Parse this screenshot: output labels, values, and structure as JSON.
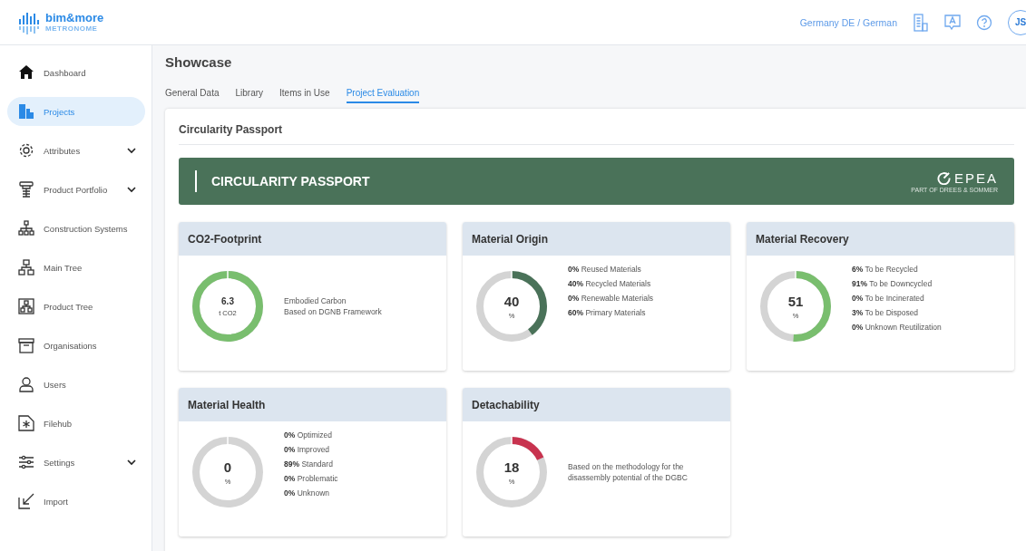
{
  "header": {
    "brand": "bim&more",
    "brand_sub": "METRONOME",
    "locale": "Germany DE / German",
    "avatar": "JS"
  },
  "sidebar": {
    "items": [
      {
        "label": "Dashboard",
        "kind": "link",
        "selected": false
      },
      {
        "label": "Projects",
        "kind": "link",
        "selected": true
      },
      {
        "label": "Attributes",
        "kind": "group",
        "selected": false
      },
      {
        "label": "Product Portfolio",
        "kind": "group",
        "selected": false
      },
      {
        "label": "Construction Systems",
        "kind": "link",
        "selected": false
      },
      {
        "label": "Main Tree",
        "kind": "link",
        "selected": false
      },
      {
        "label": "Product Tree",
        "kind": "link",
        "selected": false
      },
      {
        "label": "Organisations",
        "kind": "link",
        "selected": false
      },
      {
        "label": "Users",
        "kind": "link",
        "selected": false
      },
      {
        "label": "Filehub",
        "kind": "link",
        "selected": false
      },
      {
        "label": "Settings",
        "kind": "group",
        "selected": false
      },
      {
        "label": "Import",
        "kind": "link",
        "selected": false
      }
    ]
  },
  "page": {
    "title": "Showcase",
    "tabs": [
      {
        "label": "General Data",
        "selected": false
      },
      {
        "label": "Library",
        "selected": false
      },
      {
        "label": "Items in Use",
        "selected": false
      },
      {
        "label": "Project Evaluation",
        "selected": true
      }
    ],
    "card_title": "Circularity Passport",
    "banner": {
      "title": "CIRCULARITY PASSPORT",
      "logo": "EPEA",
      "logo_sub": "PART OF DREES & SOMMER"
    },
    "tiles": [
      {
        "title": "CO2-Footprint",
        "value": "6.3",
        "unit": "t CO2",
        "level": 1,
        "color": "#79be6e",
        "kind": "note",
        "lines": [
          "Embodied Carbon",
          "Based on DGNB Framework"
        ]
      },
      {
        "title": "Material Origin",
        "value": "40",
        "unit": "%",
        "level": 0.4,
        "color": "#4a7259",
        "kind": "list",
        "lines": [
          "**0%** Reused Materials",
          "**40%** Recycled Materials",
          "**0%** Renewable Materials",
          "**60%** Primary Materials"
        ]
      },
      {
        "title": "Material Recovery",
        "value": "51",
        "unit": "%",
        "level": 0.51,
        "color": "#79be6e",
        "kind": "list",
        "lines": [
          "**6%** To be Recycled",
          "**91%** To be Downcycled",
          "**0%** To be Incinerated",
          "**3%** To be Disposed",
          "**0%** Unknown Reutilization"
        ]
      },
      {
        "title": "Material Health",
        "value": "0",
        "unit": "%",
        "level": 0,
        "kind": "list",
        "lines": [
          "**0%** Optimized",
          "**0%** Improved",
          "**89%** Standard",
          "**0%** Problematic",
          "**0%** Unknown"
        ]
      },
      {
        "title": "Detachability",
        "value": "18",
        "unit": "%",
        "level": 0.18,
        "color": "#c8334f",
        "kind": "note",
        "lines": [
          "Based on the methodology for the",
          "disassembly potential of the DGBC"
        ]
      }
    ]
  }
}
